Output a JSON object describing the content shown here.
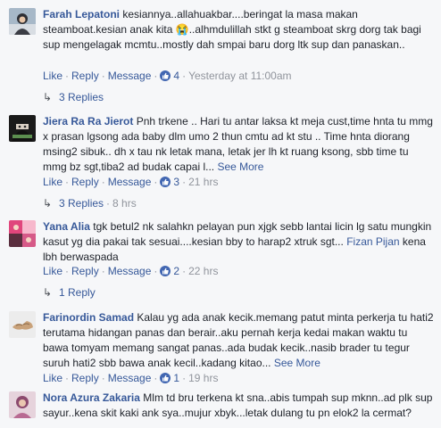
{
  "labels": {
    "like": "Like",
    "reply": "Reply",
    "message": "Message",
    "sep": "·",
    "see_more": "See More"
  },
  "comments": [
    {
      "author": "Farah Lepatoni",
      "text": "kesiannya..allahuakbar....beringat la masa makan steamboat.kesian anak kita 😭..alhmdulillah stkt g steamboat skrg dorg tak bagi sup mengelagak mcmtu..mostly dah smpai baru dorg ltk sup dan panaskan..",
      "likes": "4",
      "time": "Yesterday at 11:00am",
      "replies": "3 Replies",
      "replies_time": ""
    },
    {
      "author": "Jiera Ra Ra Jierot",
      "text": "Pnh trkene .. Hari tu antar laksa kt meja cust,time hnta tu mmg x prasan lgsong ada baby dlm umo 2 thun cmtu ad kt stu .. Time hnta diorang msing2 sibuk.. dh x tau nk letak mana, letak jer lh kt ruang ksong, sbb time tu mmg bz sgt,tiba2 ad budak capai l...",
      "likes": "3",
      "time": "21 hrs",
      "replies": "3 Replies",
      "replies_time": "8 hrs"
    },
    {
      "author": "Yana Alia",
      "text": "tgk betul2 nk salahkn pelayan pun xjgk sebb lantai licin lg satu mungkin kasut yg dia pakai tak sesuai....kesian bby to harap2 xtruk sgt...",
      "mention": "Fizan Pijan",
      "text_after": " kena lbh berwaspada",
      "likes": "2",
      "time": "22 hrs",
      "replies": "1 Reply",
      "replies_time": ""
    },
    {
      "author": "Farinordin Samad",
      "text": "Kalau yg ada anak kecik.memang patut minta perkerja tu hati2 terutama hidangan panas dan berair..aku pernah kerja kedai makan waktu tu bawa tomyam memang sangat panas..ada budak kecik..nasib brader tu tegur suruh hati2 sbb bawa anak kecil..kadang kitao...",
      "likes": "1",
      "time": "19 hrs"
    },
    {
      "author": "Nora Azura Zakaria",
      "text": "Mlm td bru terkena kt sna..abis tumpah sup mknn..ad plk sup sayur..kena skit kaki ank sya..mujur xbyk...letak dulang tu pn elok2 la cermat?"
    }
  ]
}
